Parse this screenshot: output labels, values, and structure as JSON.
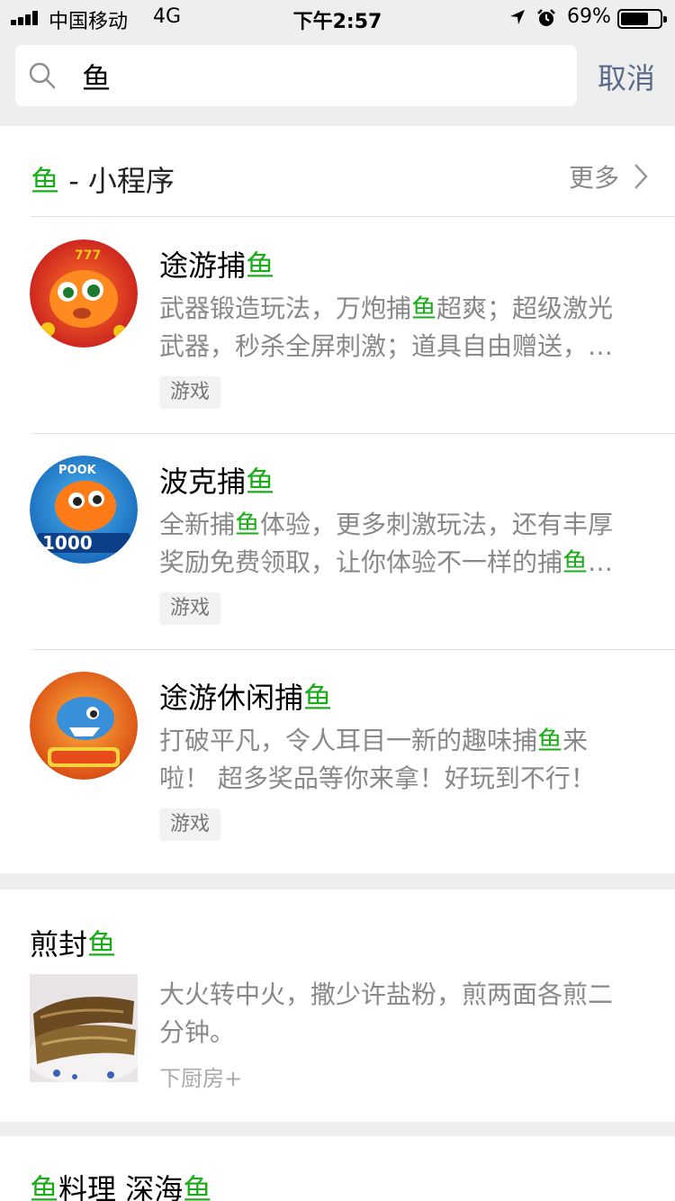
{
  "status_bar": {
    "carrier": "中国移动",
    "network": "4G",
    "time": "下午2:57",
    "battery": "69%",
    "battery_level": 0.69
  },
  "search": {
    "query": "鱼",
    "cancel_label": "取消",
    "icon": "search-icon"
  },
  "mini_programs": {
    "header_keyword": "鱼",
    "header_rest": " - 小程序",
    "more_label": "更多",
    "items": [
      {
        "title_plain": "途游捕",
        "title_hl": "鱼",
        "desc_line1_a": "武器锻造玩法，万炮捕",
        "desc_line1_hl": "鱼",
        "desc_line1_b": "超爽；超级激光",
        "desc_line2_a": "武器，秒杀全屏刺激；道具自由赠送，…",
        "desc_line2_hl": "",
        "desc_line2_b": "",
        "tag": "游戏"
      },
      {
        "title_plain": "波克捕",
        "title_hl": "鱼",
        "desc_line1_a": "全新捕",
        "desc_line1_hl": "鱼",
        "desc_line1_b": "体验，更多刺激玩法，还有丰厚",
        "desc_line2_a": "奖励免费领取，让你体验不一样的捕",
        "desc_line2_hl": "鱼",
        "desc_line2_b": "…",
        "tag": "游戏",
        "logo_text": "POOK"
      },
      {
        "title_plain": "途游休闲捕",
        "title_hl": "鱼",
        "desc_line1_a": "打破平凡，令人耳目一新的趣味捕",
        "desc_line1_hl": "鱼",
        "desc_line1_b": "来",
        "desc_line2_a": "啦！ 超多奖品等你来拿！好玩到不行！",
        "desc_line2_hl": "",
        "desc_line2_b": "",
        "tag": "游戏"
      }
    ]
  },
  "recipe": {
    "title_plain": "煎封",
    "title_hl": "鱼",
    "desc_line1": "大火转中火，撒少许盐粉，煎两面各煎二",
    "desc_line2": "分钟。",
    "source": "下厨房+"
  },
  "next_section": {
    "title_hl1": "鱼",
    "title_mid": "料理 深海",
    "title_hl2": "鱼"
  },
  "colors": {
    "highlight": "#1aad19",
    "cancel": "#5a6b8a",
    "secondary_text": "#888888",
    "background": "#eeeeef"
  }
}
